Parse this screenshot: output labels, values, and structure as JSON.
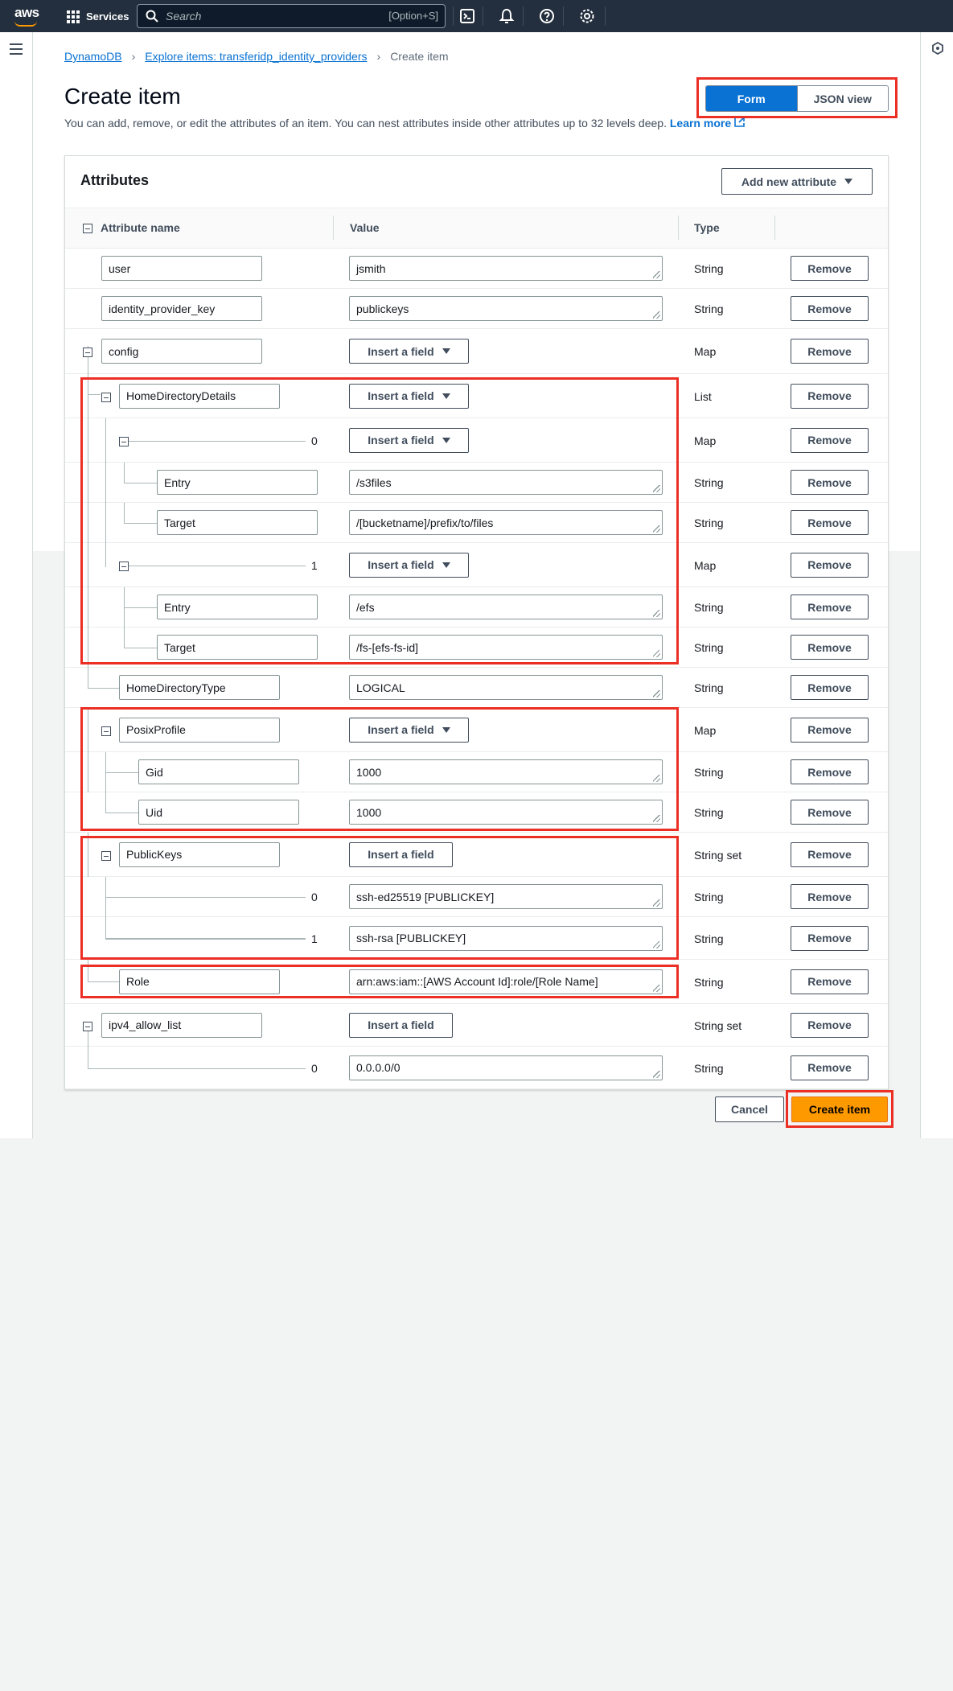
{
  "nav": {
    "logo": "aws",
    "services_label": "Services",
    "search_placeholder": "Search",
    "search_shortcut": "[Option+S]"
  },
  "breadcrumb": {
    "items": [
      "DynamoDB",
      "Explore items: transferidp_identity_providers",
      "Create item"
    ]
  },
  "header": {
    "title": "Create item",
    "description": "You can add, remove, or edit the attributes of an item. You can nest attributes inside other attributes up to 32 levels deep.",
    "learn_more": "Learn more"
  },
  "view_toggle": {
    "form": "Form",
    "json": "JSON view",
    "selected": "Form"
  },
  "attributes": {
    "title": "Attributes",
    "add_button": "Add new attribute",
    "columns": [
      "Attribute name",
      "Value",
      "Type"
    ],
    "insert_label": "Insert a field",
    "remove_label": "Remove",
    "rows": [
      {
        "name": "user",
        "value": "jsmith",
        "type": "String"
      },
      {
        "name": "identity_provider_key",
        "value": "publickeys",
        "type": "String"
      },
      {
        "name": "config",
        "type": "Map"
      },
      {
        "name": "HomeDirectoryDetails",
        "type": "List"
      },
      {
        "index": "0",
        "type": "Map"
      },
      {
        "name": "Entry",
        "value": "/s3files",
        "type": "String"
      },
      {
        "name": "Target",
        "value": "/[bucketname]/prefix/to/files",
        "type": "String"
      },
      {
        "index": "1",
        "type": "Map"
      },
      {
        "name": "Entry",
        "value": "/efs",
        "type": "String"
      },
      {
        "name": "Target",
        "value": "/fs-[efs-fs-id]",
        "type": "String"
      },
      {
        "name": "HomeDirectoryType",
        "value": "LOGICAL",
        "type": "String"
      },
      {
        "name": "PosixProfile",
        "type": "Map"
      },
      {
        "name": "Gid",
        "value": "1000",
        "type": "String"
      },
      {
        "name": "Uid",
        "value": "1000",
        "type": "String"
      },
      {
        "name": "PublicKeys",
        "type": "String set"
      },
      {
        "index": "0",
        "value": "ssh-ed25519 [PUBLICKEY]",
        "type": "String"
      },
      {
        "index": "1",
        "value": "ssh-rsa [PUBLICKEY]",
        "type": "String"
      },
      {
        "name": "Role",
        "value": "arn:aws:iam::[AWS Account Id]:role/[Role Name]",
        "type": "String"
      },
      {
        "name": "ipv4_allow_list",
        "type": "String set"
      },
      {
        "index": "0",
        "value": "0.0.0.0/0",
        "type": "String"
      }
    ]
  },
  "footer": {
    "cancel": "Cancel",
    "create": "Create item"
  },
  "colors": {
    "nav": "#232f3e",
    "primary": "#0972d3",
    "cta": "#ff9900",
    "highlight": "#ec2f25"
  }
}
